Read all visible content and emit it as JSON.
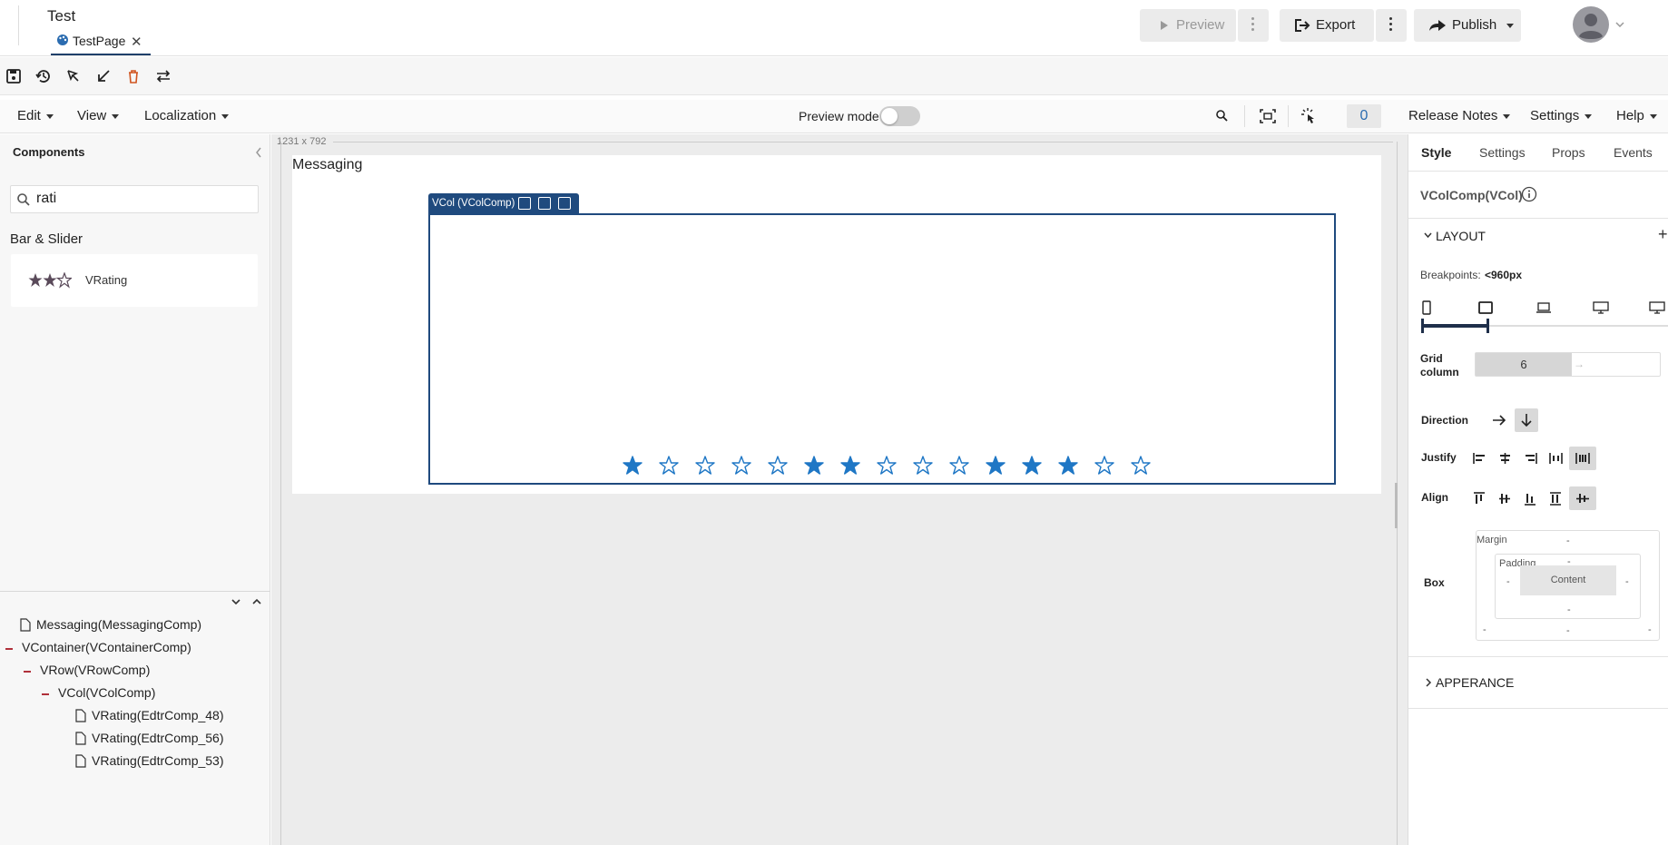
{
  "app": {
    "title": "Test",
    "tab_label": "TestPage"
  },
  "header": {
    "preview_label": "Preview",
    "export_label": "Export",
    "publish_label": "Publish"
  },
  "menubar": {
    "edit": "Edit",
    "view": "View",
    "localization": "Localization",
    "preview_mode": "Preview mode",
    "counter": "0",
    "release_notes": "Release Notes",
    "settings": "Settings",
    "help": "Help"
  },
  "left": {
    "components_title": "Components",
    "search_value": "rati",
    "category": "Bar & Slider",
    "component_name": "VRating",
    "tree": [
      {
        "label": "Messaging(MessagingComp)"
      },
      {
        "label": "VContainer(VContainerComp)"
      },
      {
        "label": "VRow(VRowComp)"
      },
      {
        "label": "VCol(VColComp)"
      },
      {
        "label": "VRating(EdtrComp_48)"
      },
      {
        "label": "VRating(EdtrComp_56)"
      },
      {
        "label": "VRating(EdtrComp_53)"
      }
    ]
  },
  "canvas": {
    "size_label": "1231 x 792",
    "page_title": "Messaging",
    "selected_tag": "VCol (VColComp)",
    "stars_filled": [
      true,
      false,
      false,
      false,
      false,
      true,
      true,
      false,
      false,
      false,
      true,
      true,
      true,
      false,
      false
    ],
    "star_color": "#1f77c5"
  },
  "right": {
    "tabs": [
      "Style",
      "Settings",
      "Props",
      "Events"
    ],
    "component_title": "VColComp(VCol)",
    "layout_label": "LAYOUT",
    "breakpoints_label": "Breakpoints:",
    "breakpoints_value": "<960px",
    "grid_label": "Grid column",
    "grid_value": "6",
    "direction_label": "Direction",
    "justify_label": "Justify",
    "align_label": "Align",
    "box_label": "Box",
    "margin_label": "Margin",
    "padding_label": "Padding",
    "content_label": "Content",
    "dash": "-",
    "appearance_label": "APPERANCE"
  },
  "colors": {
    "accent": "#1f4a7e",
    "star": "#1f77c5"
  }
}
